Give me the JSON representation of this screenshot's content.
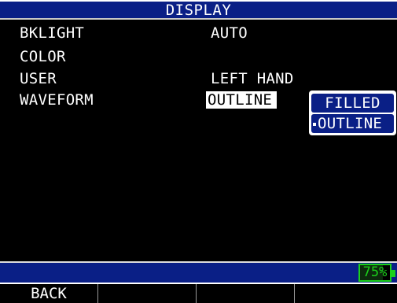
{
  "screen": {
    "title": "DISPLAY"
  },
  "menu": [
    {
      "label": "BKLIGHT",
      "value": "AUTO"
    },
    {
      "label": "COLOR",
      "value": ""
    },
    {
      "label": "USER",
      "value": "LEFT HAND"
    },
    {
      "label": "WAVEFORM",
      "value": "OUTLINE",
      "selected": true
    }
  ],
  "dropdown": {
    "options": [
      "FILLED",
      "OUTLINE"
    ],
    "current": "OUTLINE",
    "highlighted": "FILLED"
  },
  "status": {
    "battery_text": "75%",
    "battery_level": 0.75
  },
  "softkeys": [
    "BACK",
    "",
    "",
    ""
  ],
  "colors": {
    "background": "#000000",
    "bar_blue": "#0a1f86",
    "text": "#ffffff",
    "battery_green": "#1bd11b"
  }
}
